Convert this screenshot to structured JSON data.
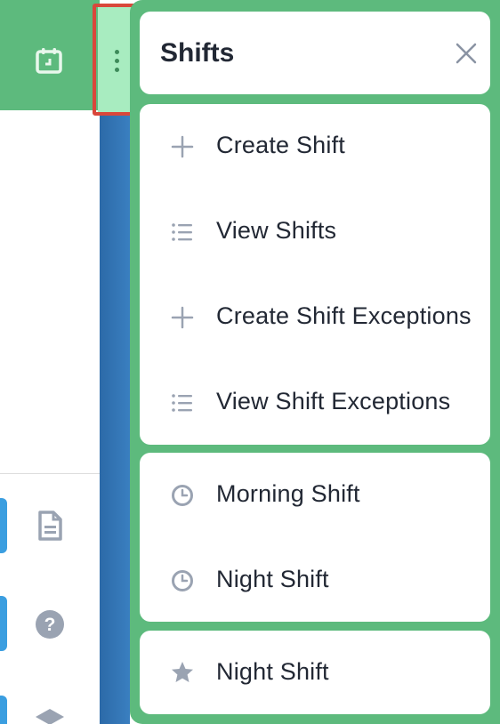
{
  "panel": {
    "title": "Shifts",
    "sections": [
      {
        "items": [
          {
            "label": "Create Shift",
            "icon": "plus-icon"
          },
          {
            "label": "View Shifts",
            "icon": "list-icon"
          },
          {
            "label": "Create Shift Exceptions",
            "icon": "plus-icon"
          },
          {
            "label": "View Shift Exceptions",
            "icon": "list-icon"
          }
        ]
      },
      {
        "items": [
          {
            "label": "Morning Shift",
            "icon": "clock-icon"
          },
          {
            "label": "Night Shift",
            "icon": "clock-icon"
          }
        ]
      },
      {
        "items": [
          {
            "label": "Night Shift",
            "icon": "star-icon"
          }
        ]
      }
    ]
  },
  "left_sidebar_icons": [
    "calendar-icon",
    "document-icon",
    "help-icon",
    "layers-icon"
  ],
  "colors": {
    "panel_green": "#5dba7d",
    "highlight_red": "#d9473b",
    "trigger_mint": "#a8ecc0",
    "stripe_blue": "#3a7fc0",
    "text_dark": "#222834",
    "icon_gray": "#9aa3b2"
  }
}
